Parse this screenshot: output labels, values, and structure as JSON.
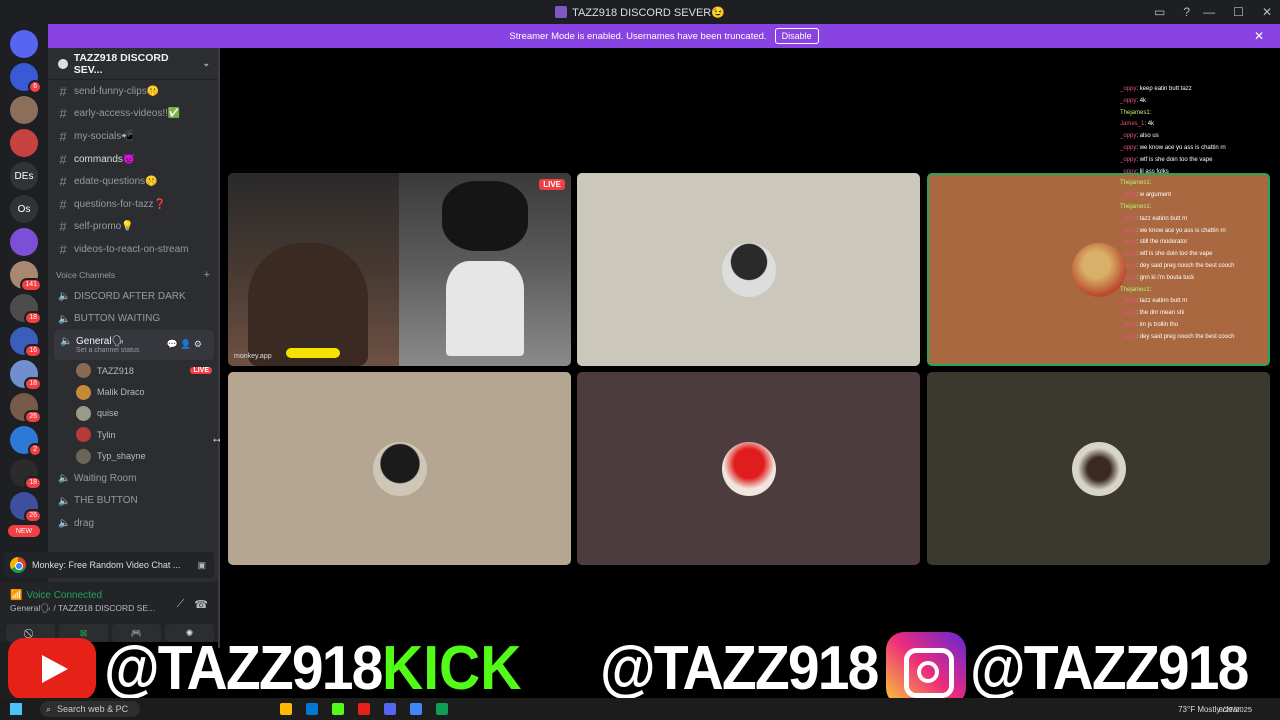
{
  "window": {
    "title": "TAZZ918 DISCORD SEVER😉"
  },
  "banner": {
    "text": "Streamer Mode is enabled. Usernames have been truncated.",
    "button": "Disable"
  },
  "guilds": {
    "items": [
      {
        "label": "",
        "color": "#5865f2",
        "icon": "discord-logo-icon"
      },
      {
        "label": "",
        "color": "#3a59d4",
        "badge": "6"
      },
      {
        "label": "",
        "color": "#8c6f5a"
      },
      {
        "label": "",
        "color": "#c94242"
      },
      {
        "label": "DEs",
        "color": "#313338"
      },
      {
        "label": "Os",
        "color": "#313338"
      },
      {
        "label": "",
        "color": "#7b4fd6",
        "badge": ""
      },
      {
        "label": "",
        "color": "#a88870",
        "badge": "141"
      },
      {
        "label": "",
        "color": "#4c4c4c",
        "badge": "18"
      },
      {
        "label": "",
        "color": "#3b5dbb",
        "badge": "16"
      },
      {
        "label": "",
        "color": "#6f8fcf",
        "badge": "18"
      },
      {
        "label": "",
        "color": "#775a4a",
        "badge": "26"
      },
      {
        "label": "",
        "color": "#2d7ad6",
        "badge": "2"
      },
      {
        "label": "",
        "color": "#2b2b2b",
        "badge": "18"
      },
      {
        "label": "",
        "color": "#3d4f9e",
        "badge": "26"
      }
    ],
    "new_label": "NEW"
  },
  "server": {
    "name": "TAZZ918 DISCORD SEV..."
  },
  "text_channels": [
    {
      "name": "send-funny-clips🤫",
      "bright": false
    },
    {
      "name": "early-access-videos!!✅",
      "bright": false
    },
    {
      "name": "my-socials📲",
      "bright": false
    },
    {
      "name": "commands😈",
      "bright": true
    },
    {
      "name": "edate-questions🤫",
      "bright": false
    },
    {
      "name": "questions-for-tazz❓",
      "bright": false
    },
    {
      "name": "self-promo💡",
      "bright": false
    },
    {
      "name": "videos-to-react-on-stream",
      "bright": false
    }
  ],
  "voice_category": "Voice Channels",
  "voice_channels_top": [
    "DISCORD AFTER DARK",
    "BUTTON WAITING"
  ],
  "active_voice": {
    "name": "General🗣",
    "status": "Set a channel status"
  },
  "members": [
    {
      "name": "TAZZ918",
      "live": "LIVE",
      "color": "#8a6a55"
    },
    {
      "name": "Malik Draco",
      "live": "",
      "color": "#c48a3a"
    },
    {
      "name": "quise",
      "live": "",
      "color": "#9a9a8a"
    },
    {
      "name": "Tylin",
      "live": "",
      "color": "#b73a3a"
    },
    {
      "name": "Typ_shayne",
      "live": "",
      "color": "#6b6559"
    }
  ],
  "voice_channels_bottom": [
    "Waiting Room",
    "THE BUTTON",
    "drag"
  ],
  "activity": {
    "text": "Monkey: Free Random Video Chat ..."
  },
  "voice_panel": {
    "status": "Voice Connected",
    "sub": "General🗣 / TAZZ918 DISCORD SE..."
  },
  "stream_tile": {
    "live": "LIVE",
    "app": "monkey.app"
  },
  "chat": [
    {
      "name": "_oppy",
      "msg": "keep eatin butt tazz"
    },
    {
      "name": "_oppy",
      "msg": "4k"
    },
    {
      "name": "Thejames1",
      "msg": ""
    },
    {
      "name": "James_1",
      "msg": "4k"
    },
    {
      "name": "_oppy",
      "msg": "also us"
    },
    {
      "name": "_oppy",
      "msg": "we know ace yo ass is chattin rn"
    },
    {
      "name": "_oppy",
      "msg": "wtf is she doin too the vape"
    },
    {
      "name": "_oppy",
      "msg": "lil ass folks"
    },
    {
      "name": "Thejames1",
      "msg": ""
    },
    {
      "name": "_oppy",
      "msg": "w argument"
    },
    {
      "name": "Thejames1",
      "msg": ""
    },
    {
      "name": "_oppy",
      "msg": "tazz eatinn butt rn"
    },
    {
      "name": "_oppy",
      "msg": "we know ace yo ass is chattin rn"
    },
    {
      "name": "_oppy",
      "msg": "still the moderator"
    },
    {
      "name": "_oppy",
      "msg": "wtf is she doin too the vape"
    },
    {
      "name": "_oppy",
      "msg": "dey said preg nooch the best cooch"
    },
    {
      "name": "_oppy",
      "msg": "gnn ki i'm bouta tuck"
    },
    {
      "name": "Thejames1",
      "msg": ""
    },
    {
      "name": "_oppy",
      "msg": "tazz eatinn butt rn"
    },
    {
      "name": "_oppy",
      "msg": "the dnr mean shi"
    },
    {
      "name": "_oppy",
      "msg": "im js trollin tho"
    },
    {
      "name": "_oppy",
      "msg": "dey said preg nooch the best cooch"
    },
    {
      "name": "_oppy",
      "msg": "gnn ki im bouta tuck"
    }
  ],
  "promo": {
    "handle": "@TAZZ918",
    "kick": "KICK"
  },
  "taskbar": {
    "search": "Search web & PC",
    "weather": "73°F Mostly clear",
    "date": "8/27/2025"
  }
}
